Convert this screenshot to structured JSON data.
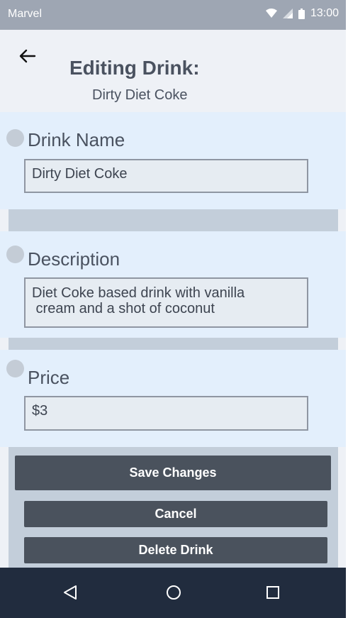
{
  "status_bar": {
    "carrier": "Marvel",
    "time": "13:00"
  },
  "header": {
    "title": "Editing Drink:",
    "subtitle": "Dirty Diet Coke"
  },
  "form": {
    "drink_name": {
      "label": "Drink Name",
      "value": "Dirty Diet Coke"
    },
    "description": {
      "label": "Description",
      "value_line1": "Diet Coke based drink with vanilla",
      "value_line2": " cream and a shot of coconut"
    },
    "price": {
      "label": "Price",
      "value": "$3"
    }
  },
  "actions": {
    "save_label": "Save Changes",
    "cancel_label": "Cancel",
    "delete_label": "Delete Drink"
  },
  "nav": {
    "icons": [
      "back-triangle-icon",
      "home-circle-icon",
      "recents-square-icon"
    ]
  },
  "colors": {
    "button": "#4a525d",
    "panel": "#e3effc",
    "navbar": "#212c3e"
  }
}
